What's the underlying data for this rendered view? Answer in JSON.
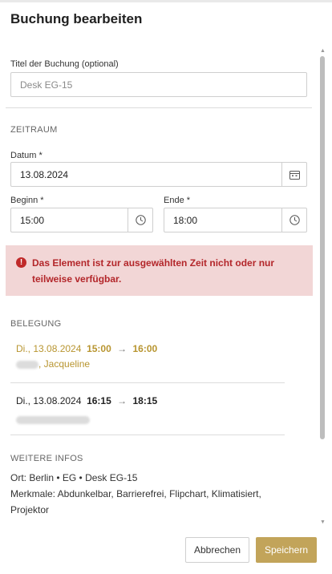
{
  "dialog": {
    "title": "Buchung bearbeiten"
  },
  "form": {
    "title_label": "Titel der Buchung (optional)",
    "title_value": "Desk EG-15",
    "section_time": "ZEITRAUM",
    "date_label": "Datum *",
    "date_value": "13.08.2024",
    "start_label": "Beginn *",
    "start_value": "15:00",
    "end_label": "Ende *",
    "end_value": "18:00"
  },
  "alert": {
    "text": "Das Element ist zur ausgewählten Zeit nicht oder nur teilweise verfügbar.",
    "icon": "!"
  },
  "occupancy": {
    "title": "BELEGUNG",
    "bookings": [
      {
        "date": "Di., 13.08.2024",
        "start": "15:00",
        "arrow": "→",
        "end": "16:00",
        "name": ", Jacqueline"
      },
      {
        "date": "Di., 13.08.2024",
        "start": "16:15",
        "arrow": "→",
        "end": "18:15",
        "name": ""
      }
    ]
  },
  "more_info": {
    "title": "WEITERE INFOS",
    "location": "Ort:  Berlin  •  EG  •  Desk EG-15",
    "features": "Merkmale: Abdunkelbar, Barrierefrei, Flipchart, Klimatisiert, Projektor"
  },
  "footer": {
    "cancel_label": "Abbrechen",
    "save_label": "Speichern"
  },
  "colors": {
    "accent": "#c2a45a",
    "alert_bg": "#f2d6d6",
    "alert_text": "#b3262a",
    "booking_highlight": "#b89530"
  }
}
